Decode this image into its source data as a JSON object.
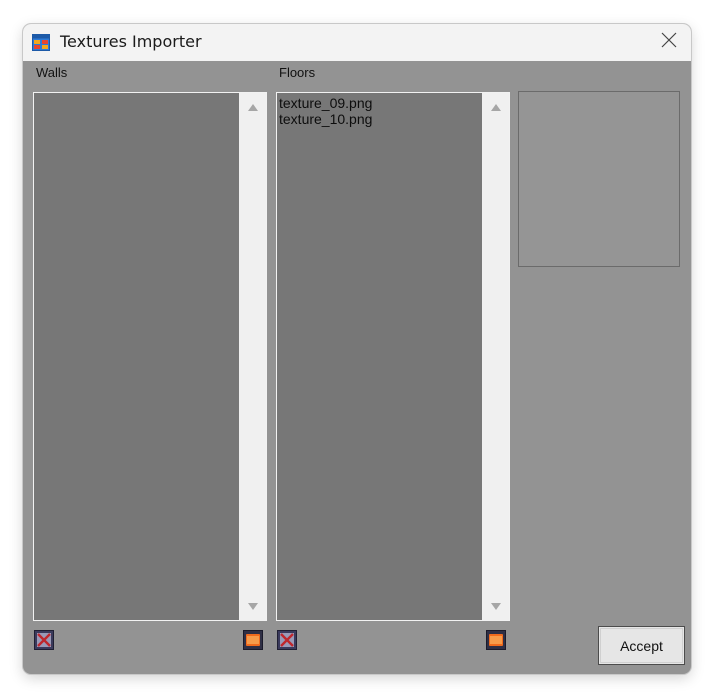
{
  "window": {
    "title": "Textures Importer",
    "icons": {
      "app": "window-app-icon",
      "close": "close-icon"
    }
  },
  "walls": {
    "label": "Walls",
    "items": []
  },
  "floors": {
    "label": "Floors",
    "items": [
      "texture_09.png",
      "texture_10.png"
    ]
  },
  "buttons": {
    "remove_icon": "remove-x-icon",
    "add_icon": "add-folder-icon",
    "accept_label": "Accept"
  },
  "colors": {
    "window_bg": "#939393",
    "list_bg": "#777777",
    "titlebar_bg": "#f3f3f3"
  }
}
